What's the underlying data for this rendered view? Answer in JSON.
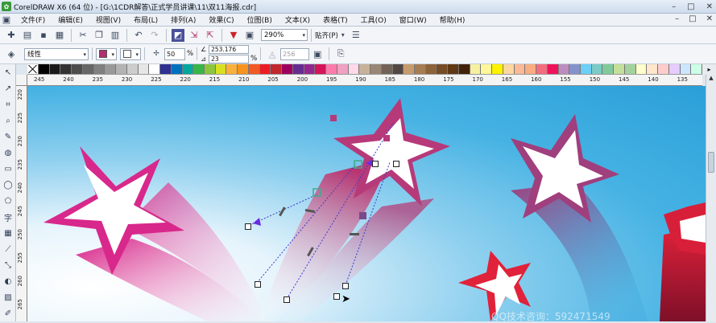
{
  "window": {
    "title": "CorelDRAW X6 (64 位) - [G:\\1CDR解答\\正式学员讲课\\11\\双11海报.cdr]",
    "app_icon_glyph": "✿",
    "controls": [
      "–",
      "□",
      "✕"
    ],
    "doc_controls": [
      "–",
      "□",
      "✕"
    ]
  },
  "menu": {
    "items": [
      "文件(F)",
      "编辑(E)",
      "视图(V)",
      "布局(L)",
      "排列(A)",
      "效果(C)",
      "位图(B)",
      "文本(X)",
      "表格(T)",
      "工具(O)",
      "窗口(W)",
      "帮助(H)"
    ]
  },
  "toolbar": {
    "zoom": "290%",
    "snap_label": "贴齐(P)"
  },
  "property_bar": {
    "tool_preset": "线性",
    "percent_value": "50",
    "percent_unit": "%",
    "angle": "253.176",
    "edge_pad": "23",
    "edge_unit": "%",
    "steps": "256"
  },
  "palette": {
    "colors": [
      "#000000",
      "#1a1a1a",
      "#333333",
      "#4d4d4d",
      "#666666",
      "#808080",
      "#999999",
      "#b3b3b3",
      "#cccccc",
      "#e6e6e6",
      "#ffffff",
      "#2e3192",
      "#0071bc",
      "#00a99d",
      "#39b54a",
      "#8cc63f",
      "#d9e021",
      "#fbb03b",
      "#f7931e",
      "#f15a24",
      "#ed1c24",
      "#c1272d",
      "#9e005d",
      "#662d91",
      "#93278f",
      "#d4145a",
      "#ff7bac",
      "#f0a0c0",
      "#ffd9e8",
      "#c7b299",
      "#998675",
      "#736357",
      "#534741",
      "#c69c6d",
      "#a67c52",
      "#8c6239",
      "#754c24",
      "#603813",
      "#42210b",
      "#f7f0a0",
      "#fff799",
      "#fff200",
      "#fdd7a0",
      "#fbb995",
      "#f9ad81",
      "#f26d7d",
      "#ee145b",
      "#bd8cbf",
      "#8493ca",
      "#6dcff6",
      "#7accc8",
      "#82ca9c",
      "#c4df9b",
      "#a3d39c",
      "#ffffcc",
      "#ffe6cc",
      "#ffcccc",
      "#e6ccff",
      "#cce6ff",
      "#ccffe6"
    ],
    "end_glyph": "▸"
  },
  "ruler": {
    "h_ticks": [
      "245",
      "240",
      "235",
      "230",
      "225",
      "220",
      "215",
      "210",
      "205",
      "200",
      "195",
      "190",
      "185",
      "180",
      "175",
      "170",
      "165",
      "160",
      "155",
      "150",
      "145",
      "140",
      "135"
    ],
    "v_ticks": [
      "220",
      "225",
      "230",
      "235",
      "240",
      "245",
      "250",
      "255",
      "260",
      "265"
    ]
  },
  "canvas": {
    "watermark": "QQ技术咨询：592471549"
  }
}
